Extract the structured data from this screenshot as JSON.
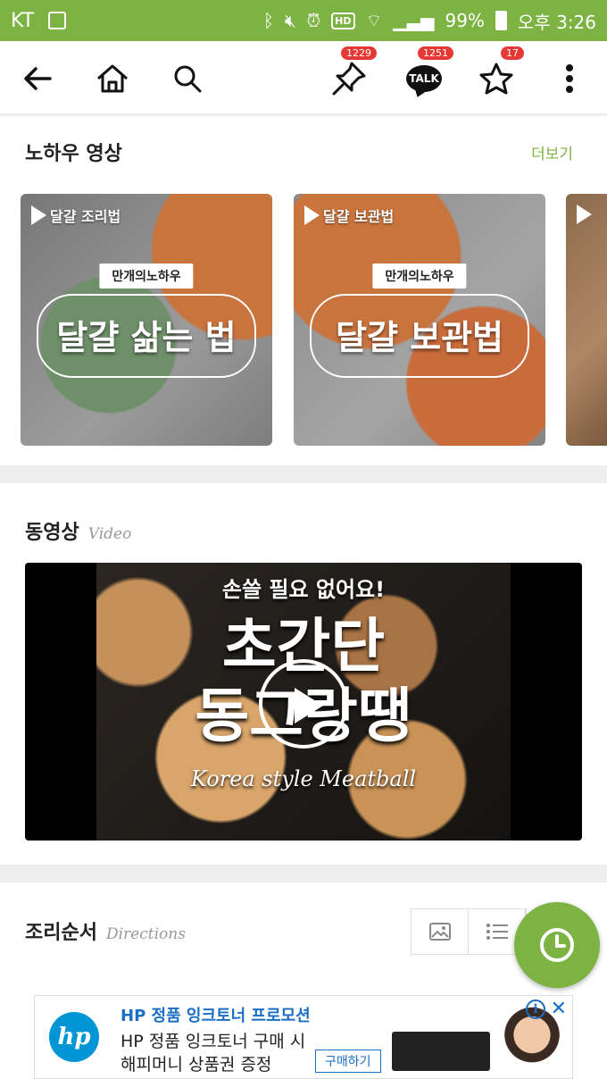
{
  "status_bar": {
    "carrier": "KT",
    "battery": "99%",
    "time": "오후 3:26",
    "hd_label": "HD"
  },
  "toolbar": {
    "pin_badge": "1229",
    "talk_badge": "1251",
    "star_badge": "17",
    "talk_label": "TALK"
  },
  "howto": {
    "title": "노하우 영상",
    "more": "더보기",
    "cards": [
      {
        "tag": "달걀 조리법",
        "ribbon": "만개의노하우",
        "headline": "달걀 삶는 법"
      },
      {
        "tag": "달걀 보관법",
        "ribbon": "만개의노하우",
        "headline": "달걀 보관법"
      },
      {
        "tag": ""
      }
    ]
  },
  "video_section": {
    "title": "동영상",
    "subtitle": "Video",
    "video": {
      "top_text": "손쓸 필요 없어요!",
      "headline_1": "초간단",
      "headline_2": "동그랑땡",
      "script": "Korea style Meatball"
    }
  },
  "directions": {
    "title": "조리순서",
    "subtitle": "Directions"
  },
  "ad": {
    "title": "HP 정품 잉크토너 프로모션",
    "line1": "HP 정품 잉크토너 구매 시",
    "line2": "해피머니 상품권 증정",
    "cta": "구매하기",
    "logo": "hp"
  },
  "colors": {
    "brand": "#7cb342",
    "badge": "#e53935",
    "divider": "#eeeeee"
  },
  "icons": [
    "back-arrow-icon",
    "home-icon",
    "search-icon",
    "pin-icon",
    "talk-icon",
    "star-icon",
    "more-vertical-icon",
    "play-icon",
    "image-icon",
    "list-icon",
    "clock-icon"
  ]
}
